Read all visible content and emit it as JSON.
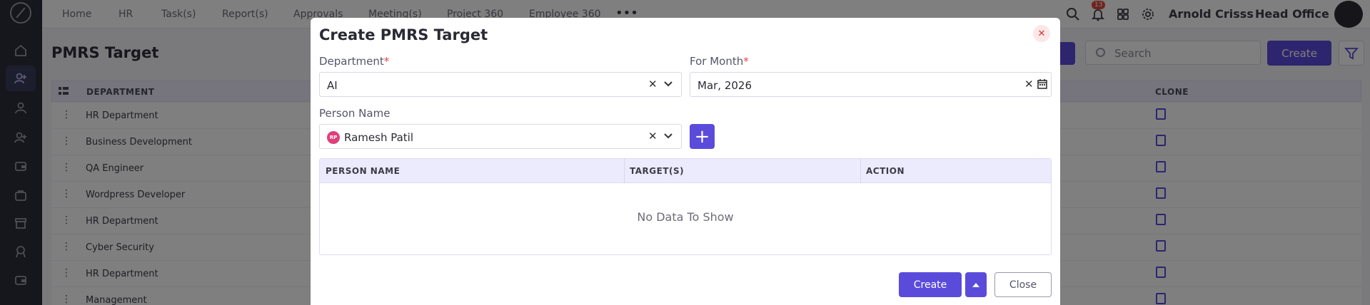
{
  "nav": {
    "items": [
      "Home",
      "HR",
      "Task(s)",
      "Report(s)",
      "Approvals",
      "Meeting(s)",
      "Project 360",
      "Employee 360"
    ],
    "notification_count": "13",
    "user_name": "Arnold Crisss",
    "office": "Head Office"
  },
  "page": {
    "title": "PMRS Target",
    "search_placeholder": "Search",
    "create_label": "Create"
  },
  "table": {
    "headers": {
      "department": "DEPARTMENT",
      "clone": "CLONE"
    },
    "rows": [
      "HR Department",
      "Business Development",
      "QA Engineer",
      "Wordpress Developer",
      "HR Department",
      "Cyber Security",
      "HR Department",
      "Management"
    ]
  },
  "modal": {
    "title": "Create PMRS Target",
    "department_label": "Department",
    "department_value": "AI",
    "month_label": "For Month",
    "month_value": "Mar, 2026",
    "person_label": "Person Name",
    "person_initials": "RP",
    "person_value": "Ramesh Patil",
    "table_headers": {
      "person": "PERSON NAME",
      "targets": "TARGET(S)",
      "action": "ACTION"
    },
    "empty_text": "No Data To Show",
    "create_label": "Create",
    "close_label": "Close",
    "required_mark": "*",
    "add_symbol": "+",
    "clear_symbol": "✕"
  },
  "colors": {
    "accent": "#5b4bdb",
    "danger": "#e0483e",
    "header_bg": "#ecebfd"
  }
}
